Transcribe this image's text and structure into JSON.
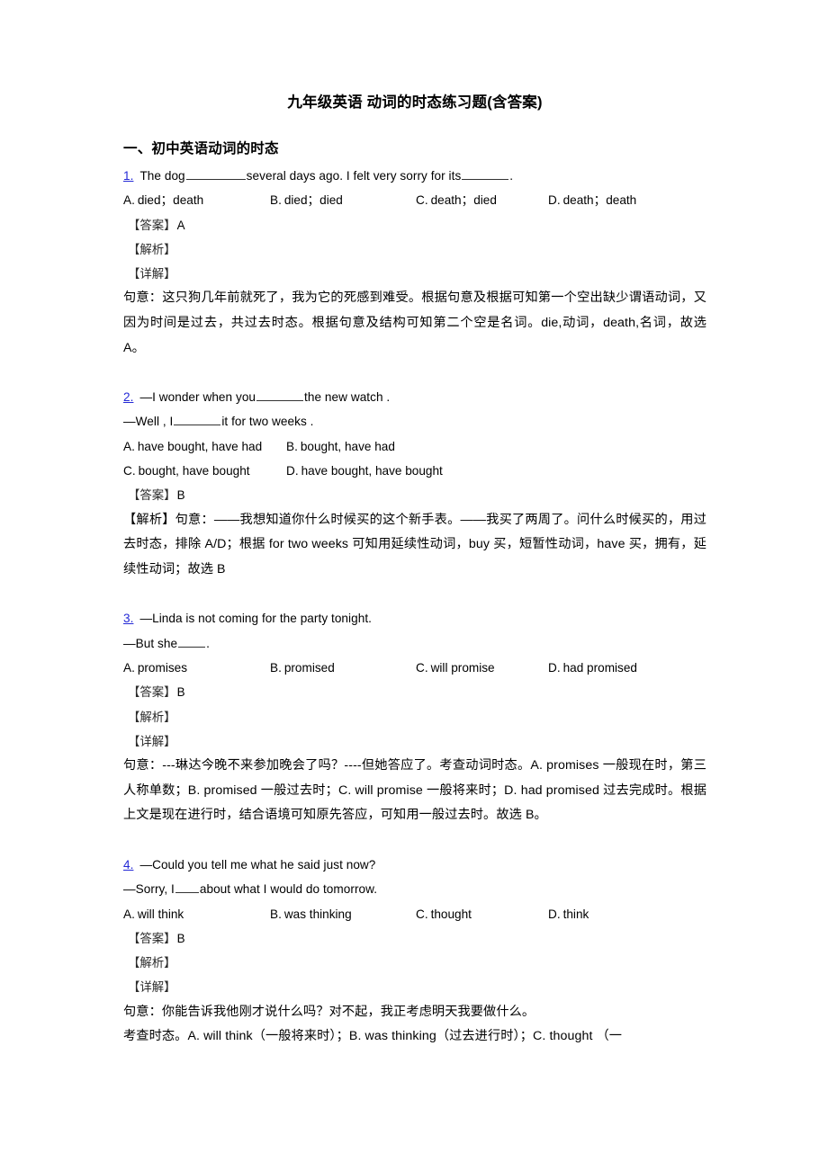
{
  "document": {
    "title": "九年级英语 动词的时态练习题(含答案)",
    "section_heading": "一、初中英语动词的时态",
    "labels": {
      "answer_tag": "【答案】",
      "analysis_tag": "【解析】",
      "detail_tag": "【详解】"
    },
    "accent_color": "#2429d6"
  },
  "questions": [
    {
      "number": "1.",
      "stem_before": "The dog",
      "stem_middle": "several days ago. I felt very sorry for its",
      "stem_after": ".",
      "options": [
        {
          "letter": "A.",
          "text": "died；death"
        },
        {
          "letter": "B.",
          "text": "died；died"
        },
        {
          "letter": "C.",
          "text": "death；died"
        },
        {
          "letter": "D.",
          "text": "death；death"
        }
      ],
      "answer": "A",
      "analysis_tag": "【解析】",
      "detail_tag": "【详解】",
      "analysis_text": "句意：这只狗几年前就死了，我为它的死感到难受。根据句意及根据可知第一个空出缺少谓语动词，又因为时间是过去，共过去时态。根据句意及结构可知第二个空是名词。die,动词，death,名词，故选 A。"
    },
    {
      "number": "2.",
      "stem_line1_before": "—I wonder when you",
      "stem_line1_after": "the new watch .",
      "stem_line2_before": "—Well , I",
      "stem_line2_after": "it for two weeks .",
      "options": [
        {
          "letter": "A.",
          "text": "have bought, have had"
        },
        {
          "letter": "B.",
          "text": "bought, have had"
        },
        {
          "letter": "C.",
          "text": "bought, have bought"
        },
        {
          "letter": "D.",
          "text": "have bought, have bought"
        }
      ],
      "answer": "B",
      "analysis_inline": "【解析】句意：——我想知道你什么时候买的这个新手表。——我买了两周了。问什么时候买的，用过去时态，排除 A/D；根据 for two weeks 可知用延续性动词，buy 买，短暂性动词，have 买，拥有，延续性动词；故选 B"
    },
    {
      "number": "3.",
      "stem_line1": "—Linda is not coming for the party tonight.",
      "stem_line2_before": "—But she",
      "stem_line2_after": ".",
      "options": [
        {
          "letter": "A.",
          "text": "promises"
        },
        {
          "letter": "B.",
          "text": "promised"
        },
        {
          "letter": "C.",
          "text": "will promise"
        },
        {
          "letter": "D.",
          "text": "had promised"
        }
      ],
      "answer": "B",
      "analysis_tag": "【解析】",
      "detail_tag": "【详解】",
      "analysis_text": "句意：---琳达今晚不来参加晚会了吗？----但她答应了。考查动词时态。A. promises 一般现在时，第三人称单数；B. promised 一般过去时；C. will promise 一般将来时；D. had promised 过去完成时。根据上文是现在进行时，结合语境可知原先答应，可知用一般过去时。故选 B。"
    },
    {
      "number": "4.",
      "stem_line1": "—Could you tell me what he said just now?",
      "stem_line2_before": "—Sorry, I",
      "stem_line2_after": "about what I would do tomorrow.",
      "options": [
        {
          "letter": "A.",
          "text": "will think"
        },
        {
          "letter": "B.",
          "text": "was thinking"
        },
        {
          "letter": "C.",
          "text": "thought"
        },
        {
          "letter": "D.",
          "text": "think"
        }
      ],
      "answer": "B",
      "analysis_tag": "【解析】",
      "detail_tag": "【详解】",
      "analysis_line1": "句意：你能告诉我他刚才说什么吗？对不起，我正考虑明天我要做什么。",
      "analysis_line2": "考查时态。A. will think（一般将来时）；B. was thinking（过去进行时）；C. thought  （一"
    }
  ]
}
